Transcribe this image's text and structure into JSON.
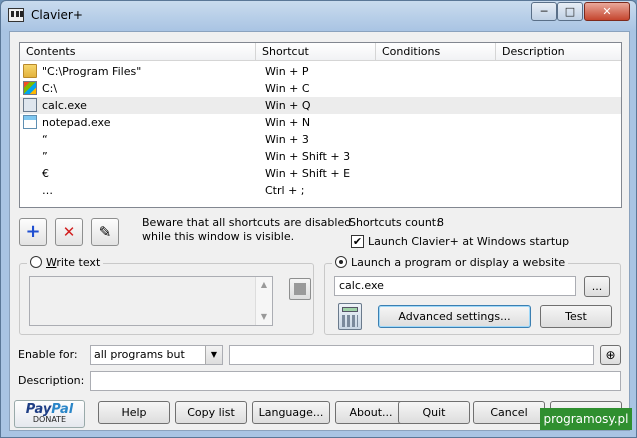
{
  "window": {
    "title": "Clavier+"
  },
  "titlebar": {
    "minimize": "─",
    "maximize": "□",
    "close": "✕"
  },
  "list": {
    "columns": [
      "Contents",
      "Shortcut",
      "Conditions",
      "Description"
    ],
    "rows": [
      {
        "icon": "folder-icon",
        "contents": "\"C:\\Program Files\"",
        "shortcut": "Win + P"
      },
      {
        "icon": "drive-icon",
        "contents": "C:\\",
        "shortcut": "Win + C"
      },
      {
        "icon": "calculator-icon",
        "contents": "calc.exe",
        "shortcut": "Win + Q"
      },
      {
        "icon": "notepad-icon",
        "contents": "notepad.exe",
        "shortcut": "Win + N"
      },
      {
        "icon": "",
        "contents": "“",
        "shortcut": "Win + 3"
      },
      {
        "icon": "",
        "contents": "”",
        "shortcut": "Win + Shift + 3"
      },
      {
        "icon": "",
        "contents": "€",
        "shortcut": "Win + Shift + E"
      },
      {
        "icon": "",
        "contents": "…",
        "shortcut": "Ctrl + ;"
      }
    ]
  },
  "toolbar": {
    "add": "+",
    "delete": "✕",
    "edit": "✎"
  },
  "info": {
    "warning_line1": "Beware that all shortcuts are disabled",
    "warning_line2": "while this window is visible.",
    "count_label": "Shortcuts count:",
    "count_value": "8",
    "startup_label": "Launch Clavier+ at Windows startup",
    "startup_checked": "✔"
  },
  "write_text": {
    "label": "Write text",
    "label_underline": "W",
    "label_rest": "rite text"
  },
  "launch": {
    "label": "Launch a program or display a website",
    "value": "calc.exe",
    "browse": "...",
    "advanced": "Advanced settings...",
    "test": "Test"
  },
  "enable_for": {
    "label": "Enable for:",
    "value": "all programs but",
    "target": ""
  },
  "description": {
    "label": "Description:",
    "value": ""
  },
  "paypal": {
    "brand_a": "Pay",
    "brand_b": "Pal",
    "donate": "DONATE"
  },
  "buttons": {
    "help": "Help",
    "copy_list": "Copy list",
    "language": "Language...",
    "about": "About...",
    "quit": "Quit",
    "cancel": "Cancel",
    "ok": "OK"
  },
  "watermark": "programosy.pl"
}
